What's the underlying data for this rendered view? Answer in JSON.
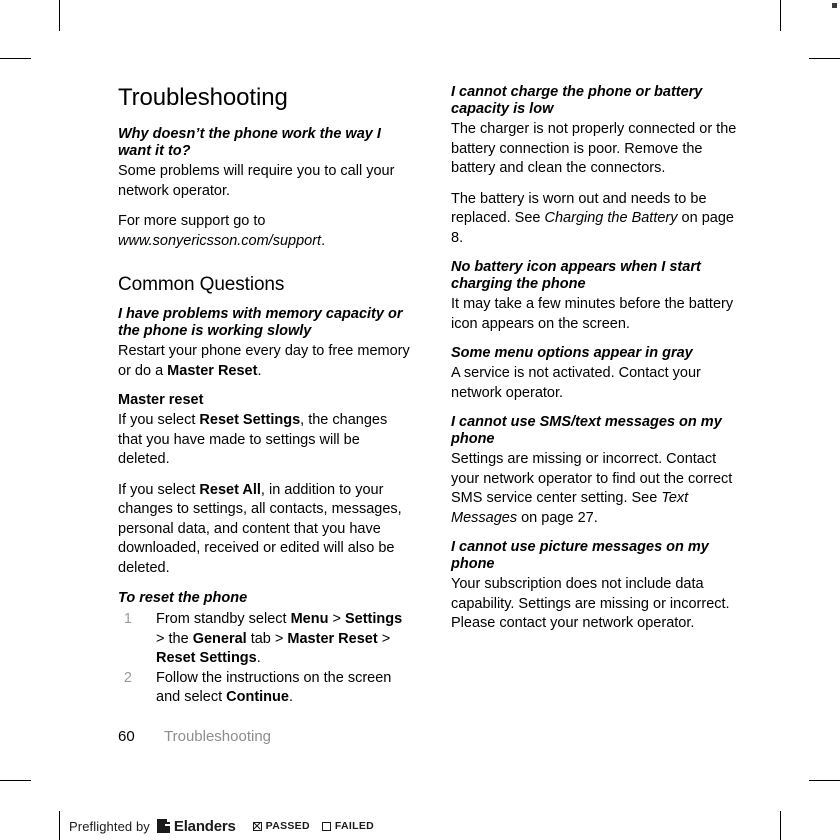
{
  "document": {
    "title": "Troubleshooting",
    "section_title": "Common Questions"
  },
  "left_column": {
    "q1": {
      "heading": "Why doesn’t the phone work the way I want it to?",
      "answer": "Some problems will require you to call your network operator.",
      "support_line_1": "For more support go to ",
      "support_url": "www.sonyericsson.com/support",
      "support_period": "."
    },
    "q2": {
      "heading": "I have problems with memory capacity or the phone is working slowly",
      "answer_pre": "Restart your phone every day to free memory or do a ",
      "answer_bold": "Master Reset",
      "answer_post": "."
    },
    "master_reset": {
      "subheading": "Master reset",
      "p1_pre": "If you select ",
      "p1_bold": "Reset Settings",
      "p1_post": ", the changes that you have made to settings will be deleted.",
      "p2_pre": "If you select ",
      "p2_bold": "Reset All",
      "p2_post": ", in addition to your changes to settings, all contacts, messages, personal data, and content that you have downloaded, received or edited will also be deleted."
    },
    "procedure": {
      "heading": "To reset the phone",
      "steps": [
        {
          "num": "1",
          "parts": [
            {
              "t": "From standby select ",
              "b": false
            },
            {
              "t": "Menu",
              "b": true
            },
            {
              "t": " > ",
              "b": false
            },
            {
              "t": "Settings",
              "b": true
            },
            {
              "t": " > the ",
              "b": false
            },
            {
              "t": "General",
              "b": true
            },
            {
              "t": " tab > ",
              "b": false
            },
            {
              "t": "Master Reset",
              "b": true
            },
            {
              "t": " > ",
              "b": false
            },
            {
              "t": "Reset Settings",
              "b": true
            },
            {
              "t": ".",
              "b": false
            }
          ]
        },
        {
          "num": "2",
          "parts": [
            {
              "t": "Follow the instructions on the screen and select ",
              "b": false
            },
            {
              "t": "Continue",
              "b": true
            },
            {
              "t": ".",
              "b": false
            }
          ]
        }
      ]
    }
  },
  "right_column": {
    "q3": {
      "heading": "I cannot charge the phone or battery capacity is low",
      "answer_1": "The charger is not properly connected or the battery connection is poor. Remove the battery and clean the connectors.",
      "answer_2_pre": "The battery is worn out and needs to be replaced. See ",
      "answer_2_italic": "Charging the Battery",
      "answer_2_post": " on page 8."
    },
    "q4": {
      "heading": "No battery icon appears when I start charging the phone",
      "answer": "It may take a few minutes before the battery icon appears on the screen."
    },
    "q5": {
      "heading": "Some menu options appear in gray",
      "answer": "A service is not activated. Contact your network operator."
    },
    "q6": {
      "heading": "I cannot use SMS/text messages on my phone",
      "answer_pre": "Settings are missing or incorrect. Contact your network operator to find out the correct SMS service center setting. See ",
      "answer_italic": "Text Messages",
      "answer_post": " on page 27."
    },
    "q7": {
      "heading": "I cannot use picture messages on my phone",
      "answer": "Your subscription does not include data capability. Settings are missing or incorrect. Please contact your network operator."
    }
  },
  "footer": {
    "page_number": "60",
    "running_head": "Troubleshooting"
  },
  "preflight": {
    "prefix": "Preflighted by",
    "brand": "Elanders",
    "passed_label": "PASSED",
    "failed_label": "FAILED",
    "passed_checked": true,
    "failed_checked": false
  },
  "colors": {
    "text": "#000000",
    "muted": "#8d8d8d",
    "step_number": "#9b9b9b",
    "stamp": "#1b1b1b"
  }
}
